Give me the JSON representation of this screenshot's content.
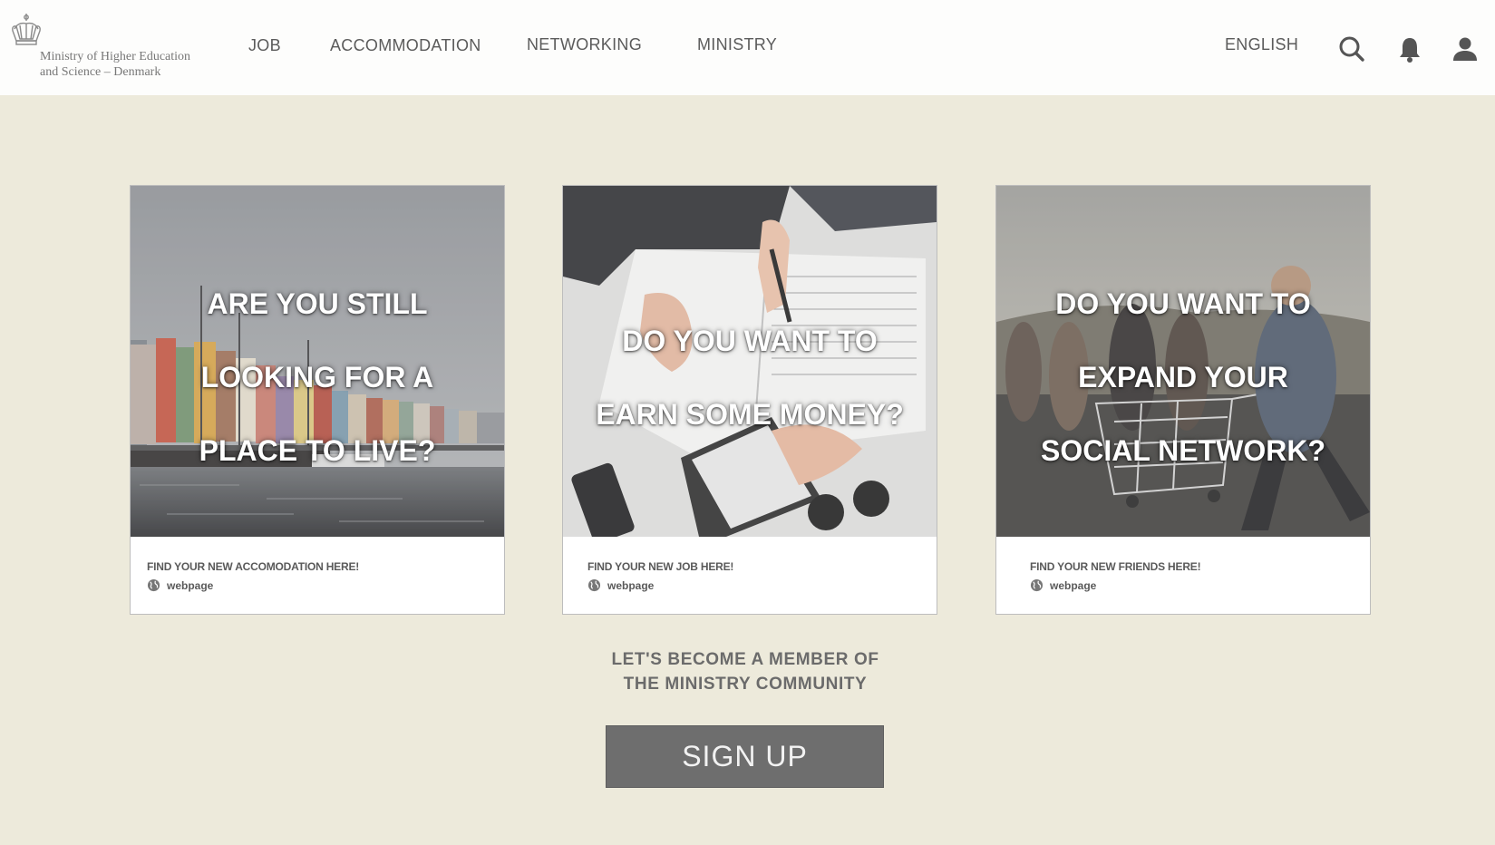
{
  "header": {
    "logo": {
      "line1": "Ministry of Higher Education",
      "line2": "and Science – Denmark"
    },
    "nav": [
      "JOB",
      "ACCOMMODATION",
      "NETWORKING",
      "MINISTRY"
    ],
    "language": "ENGLISH",
    "icons": [
      "search-icon",
      "bell-icon",
      "user-icon"
    ]
  },
  "cards": [
    {
      "headline": [
        "ARE YOU STILL",
        "LOOKING FOR A",
        "PLACE TO LIVE?"
      ],
      "footer_title": "FIND YOUR NEW ACCOMODATION HERE!",
      "link_label": "webpage",
      "image": "harbor-photo"
    },
    {
      "headline": [
        "DO YOU WANT TO",
        "EARN SOME MONEY?"
      ],
      "footer_title": "FIND YOUR NEW JOB HERE!",
      "link_label": "webpage",
      "image": "desk-work-photo"
    },
    {
      "headline": [
        "DO YOU WANT TO",
        "EXPAND YOUR",
        "SOCIAL NETWORK?"
      ],
      "footer_title": "FIND YOUR NEW FRIENDS HERE!",
      "link_label": "webpage",
      "image": "friends-shopping-cart-photo"
    }
  ],
  "cta": {
    "line1": "LET'S BECOME A MEMBER OF",
    "line2": "THE MINISTRY COMMUNITY",
    "button": "SIGN UP"
  },
  "colors": {
    "page_background": "#edeadb",
    "header_background": "#fdfdfc",
    "button_background": "#6e6e6e",
    "text": "#5b5b5b"
  }
}
